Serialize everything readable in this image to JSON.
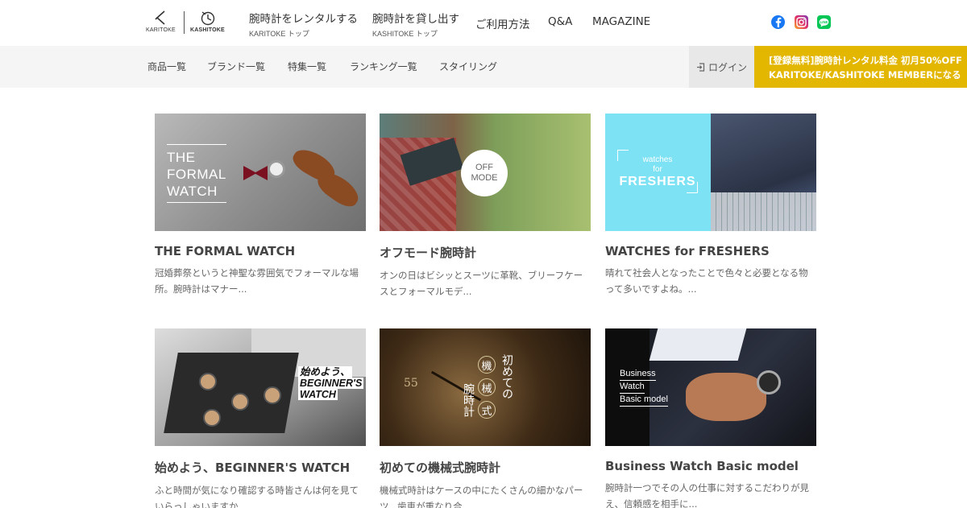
{
  "header": {
    "karitoke_logo": "KARITOKE",
    "kashitoke_logo": "KASHITOKE",
    "nav": [
      {
        "label": "腕時計をレンタルする",
        "sub": "KARITOKE トップ"
      },
      {
        "label": "腕時計を貸し出す",
        "sub": "KASHITOKE トップ"
      }
    ],
    "links": [
      "ご利用方法",
      "Q&A",
      "MAGAZINE"
    ],
    "social": [
      "facebook-icon",
      "instagram-icon",
      "line-icon"
    ]
  },
  "subnav": {
    "items": [
      "商品一覧",
      "ブランド一覧",
      "特集一覧",
      "ランキング一覧",
      "スタイリング"
    ],
    "login": "ログイン",
    "promo_line1": "[登録無料]腕時計レンタル料金 初月50%OFF",
    "promo_line2": "KARITOKE/KASHITOKE MEMBERになる"
  },
  "cards": [
    {
      "title": "THE FORMAL WATCH",
      "desc": "冠婚葬祭というと神聖な雰囲気でフォーマルな場所。腕時計はマナー...",
      "thumb_text": [
        "THE",
        "FORMAL",
        "WATCH"
      ]
    },
    {
      "title": "オフモード腕時計",
      "desc": "オンの日はビシッとスーツに革靴、ブリーフケースとフォーマルモデ...",
      "thumb_text": [
        "OFF",
        "MODE"
      ]
    },
    {
      "title": "WATCHES for FRESHERS",
      "desc": "晴れて社会人となったことで色々と必要となる物って多いですよね。...",
      "thumb_text": [
        "watches",
        "for",
        "FRESHERS"
      ]
    },
    {
      "title": "始めよう、BEGINNER'S WATCH",
      "desc": "ふと時間が気になり確認する時皆さんは何を見ていらっしゃいますか...",
      "thumb_text": [
        "始めよう、",
        "BEGINNER'S",
        "WATCH"
      ]
    },
    {
      "title": "初めての機械式腕時計",
      "desc": "機械式時計はケースの中にたくさんの細かなパーツ、歯車が重なり合...",
      "thumb_text": [
        "初めての",
        "機",
        "械",
        "式",
        "腕時計"
      ]
    },
    {
      "title": "Business Watch Basic model",
      "desc": "腕時計一つでその人の仕事に対するこだわりが見え、信頼感を相手に...",
      "thumb_text": [
        "Business",
        "Watch",
        "Basic model"
      ]
    }
  ],
  "colors": {
    "promo": "#e3b600",
    "subnav_bg": "#f5f5f5",
    "login_bg": "#e8e8e8"
  }
}
